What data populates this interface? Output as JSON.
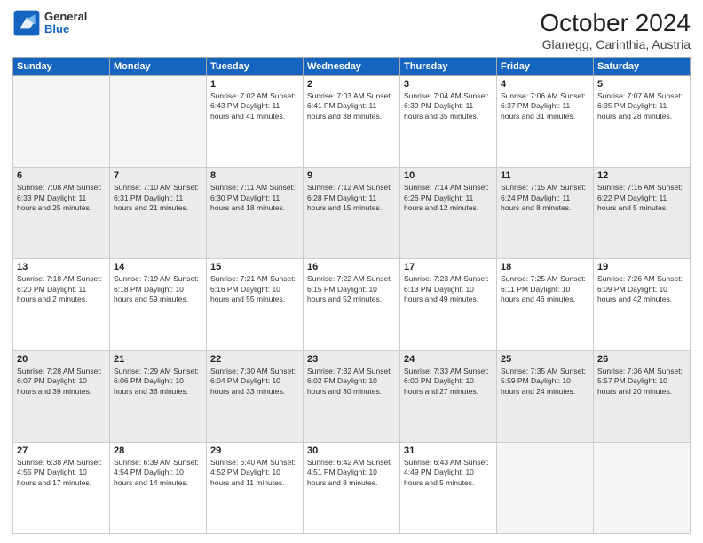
{
  "logo": {
    "general": "General",
    "blue": "Blue"
  },
  "header": {
    "month_year": "October 2024",
    "location": "Glanegg, Carinthia, Austria"
  },
  "days_of_week": [
    "Sunday",
    "Monday",
    "Tuesday",
    "Wednesday",
    "Thursday",
    "Friday",
    "Saturday"
  ],
  "weeks": [
    [
      {
        "day": "",
        "info": ""
      },
      {
        "day": "",
        "info": ""
      },
      {
        "day": "1",
        "info": "Sunrise: 7:02 AM\nSunset: 6:43 PM\nDaylight: 11 hours and 41 minutes."
      },
      {
        "day": "2",
        "info": "Sunrise: 7:03 AM\nSunset: 6:41 PM\nDaylight: 11 hours and 38 minutes."
      },
      {
        "day": "3",
        "info": "Sunrise: 7:04 AM\nSunset: 6:39 PM\nDaylight: 11 hours and 35 minutes."
      },
      {
        "day": "4",
        "info": "Sunrise: 7:06 AM\nSunset: 6:37 PM\nDaylight: 11 hours and 31 minutes."
      },
      {
        "day": "5",
        "info": "Sunrise: 7:07 AM\nSunset: 6:35 PM\nDaylight: 11 hours and 28 minutes."
      }
    ],
    [
      {
        "day": "6",
        "info": "Sunrise: 7:08 AM\nSunset: 6:33 PM\nDaylight: 11 hours and 25 minutes."
      },
      {
        "day": "7",
        "info": "Sunrise: 7:10 AM\nSunset: 6:31 PM\nDaylight: 11 hours and 21 minutes."
      },
      {
        "day": "8",
        "info": "Sunrise: 7:11 AM\nSunset: 6:30 PM\nDaylight: 11 hours and 18 minutes."
      },
      {
        "day": "9",
        "info": "Sunrise: 7:12 AM\nSunset: 6:28 PM\nDaylight: 11 hours and 15 minutes."
      },
      {
        "day": "10",
        "info": "Sunrise: 7:14 AM\nSunset: 6:26 PM\nDaylight: 11 hours and 12 minutes."
      },
      {
        "day": "11",
        "info": "Sunrise: 7:15 AM\nSunset: 6:24 PM\nDaylight: 11 hours and 8 minutes."
      },
      {
        "day": "12",
        "info": "Sunrise: 7:16 AM\nSunset: 6:22 PM\nDaylight: 11 hours and 5 minutes."
      }
    ],
    [
      {
        "day": "13",
        "info": "Sunrise: 7:18 AM\nSunset: 6:20 PM\nDaylight: 11 hours and 2 minutes."
      },
      {
        "day": "14",
        "info": "Sunrise: 7:19 AM\nSunset: 6:18 PM\nDaylight: 10 hours and 59 minutes."
      },
      {
        "day": "15",
        "info": "Sunrise: 7:21 AM\nSunset: 6:16 PM\nDaylight: 10 hours and 55 minutes."
      },
      {
        "day": "16",
        "info": "Sunrise: 7:22 AM\nSunset: 6:15 PM\nDaylight: 10 hours and 52 minutes."
      },
      {
        "day": "17",
        "info": "Sunrise: 7:23 AM\nSunset: 6:13 PM\nDaylight: 10 hours and 49 minutes."
      },
      {
        "day": "18",
        "info": "Sunrise: 7:25 AM\nSunset: 6:11 PM\nDaylight: 10 hours and 46 minutes."
      },
      {
        "day": "19",
        "info": "Sunrise: 7:26 AM\nSunset: 6:09 PM\nDaylight: 10 hours and 42 minutes."
      }
    ],
    [
      {
        "day": "20",
        "info": "Sunrise: 7:28 AM\nSunset: 6:07 PM\nDaylight: 10 hours and 39 minutes."
      },
      {
        "day": "21",
        "info": "Sunrise: 7:29 AM\nSunset: 6:06 PM\nDaylight: 10 hours and 36 minutes."
      },
      {
        "day": "22",
        "info": "Sunrise: 7:30 AM\nSunset: 6:04 PM\nDaylight: 10 hours and 33 minutes."
      },
      {
        "day": "23",
        "info": "Sunrise: 7:32 AM\nSunset: 6:02 PM\nDaylight: 10 hours and 30 minutes."
      },
      {
        "day": "24",
        "info": "Sunrise: 7:33 AM\nSunset: 6:00 PM\nDaylight: 10 hours and 27 minutes."
      },
      {
        "day": "25",
        "info": "Sunrise: 7:35 AM\nSunset: 5:59 PM\nDaylight: 10 hours and 24 minutes."
      },
      {
        "day": "26",
        "info": "Sunrise: 7:36 AM\nSunset: 5:57 PM\nDaylight: 10 hours and 20 minutes."
      }
    ],
    [
      {
        "day": "27",
        "info": "Sunrise: 6:38 AM\nSunset: 4:55 PM\nDaylight: 10 hours and 17 minutes."
      },
      {
        "day": "28",
        "info": "Sunrise: 6:39 AM\nSunset: 4:54 PM\nDaylight: 10 hours and 14 minutes."
      },
      {
        "day": "29",
        "info": "Sunrise: 6:40 AM\nSunset: 4:52 PM\nDaylight: 10 hours and 11 minutes."
      },
      {
        "day": "30",
        "info": "Sunrise: 6:42 AM\nSunset: 4:51 PM\nDaylight: 10 hours and 8 minutes."
      },
      {
        "day": "31",
        "info": "Sunrise: 6:43 AM\nSunset: 4:49 PM\nDaylight: 10 hours and 5 minutes."
      },
      {
        "day": "",
        "info": ""
      },
      {
        "day": "",
        "info": ""
      }
    ]
  ]
}
